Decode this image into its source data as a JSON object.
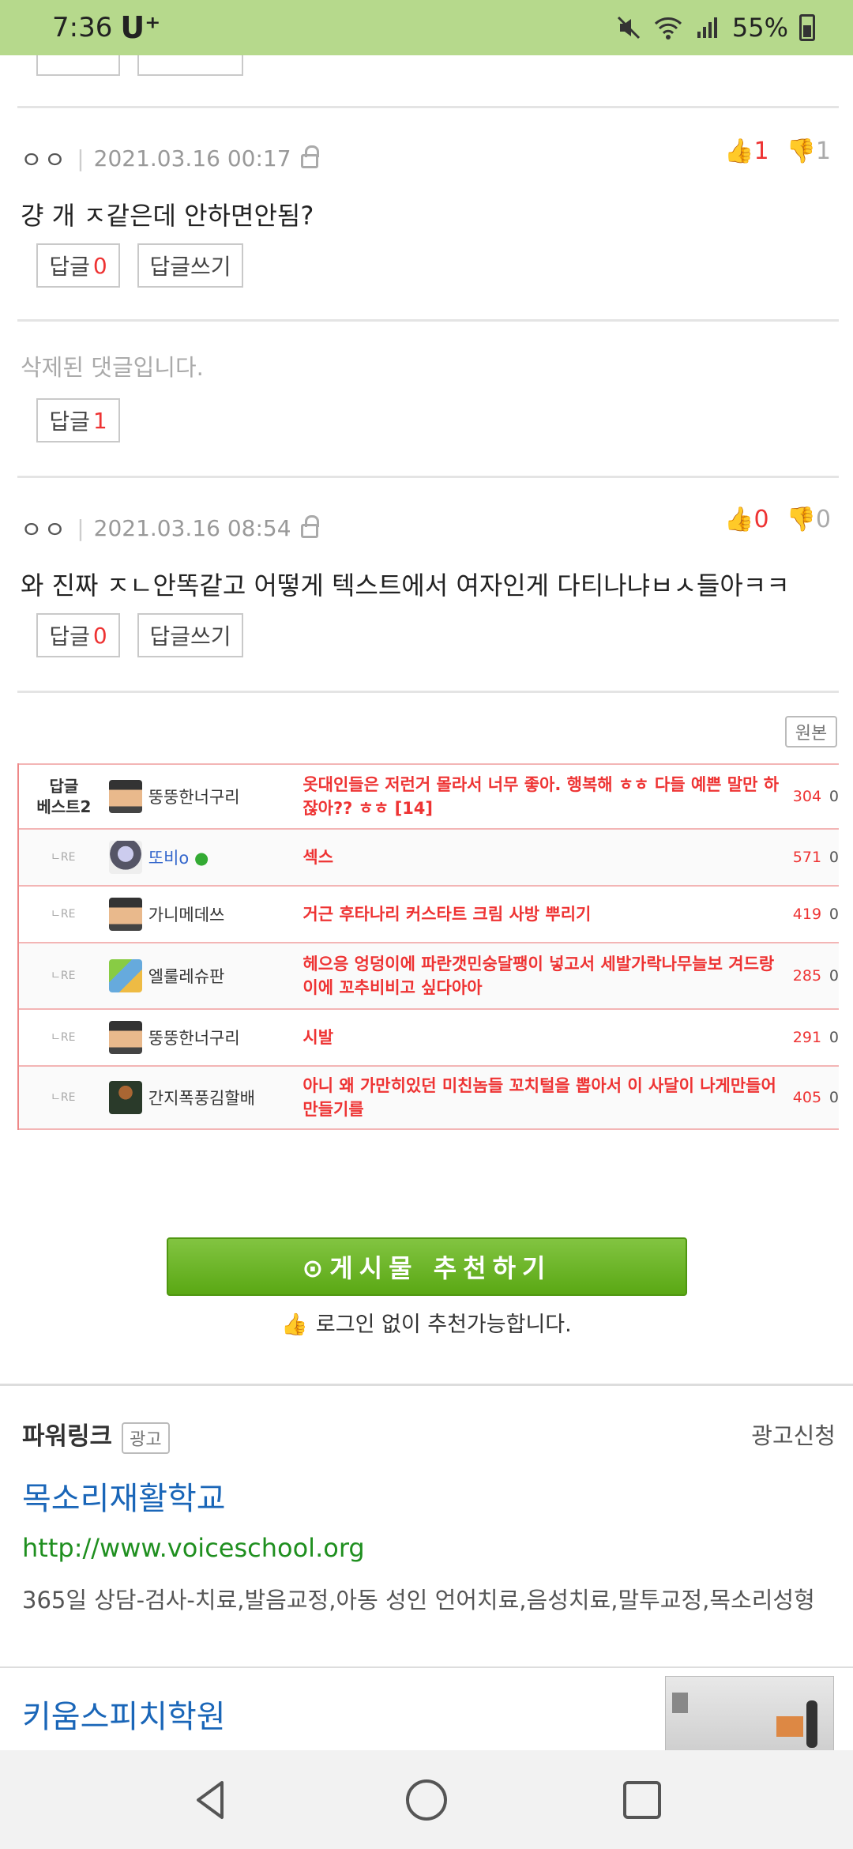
{
  "status": {
    "time": "7:36",
    "carrier": "U⁺",
    "battery": "55%"
  },
  "comments": [
    {
      "nick": "ㅇㅇ",
      "date": "2021.03.16 00:17",
      "up": "1",
      "down": "1",
      "text": "걍 개 ㅈ같은데 안하면안됨?",
      "reply_label": "답글",
      "reply_count": "0",
      "write_label": "답글쓰기"
    },
    {
      "deleted_text": "삭제된 댓글입니다.",
      "reply_label": "답글",
      "reply_count": "1"
    },
    {
      "nick": "ㅇㅇ",
      "date": "2021.03.16 08:54",
      "up": "0",
      "down": "0",
      "text": "와 진짜 ㅈㄴ안똑같고 어떻게 텍스트에서 여자인게 다티나냐ㅂㅅ들아ㅋㅋ",
      "reply_label": "답글",
      "reply_count": "0",
      "write_label": "답글쓰기"
    }
  ],
  "original_label": "원본",
  "best_replies": {
    "label": "답글\n베스트2",
    "re_label": "ㄴRE",
    "rows": [
      {
        "nick": "뚱뚱한너구리",
        "text": "옷대인들은 저런거 몰라서 너무 좋아. 행복해 ㅎㅎ 다들 예쁜 말만 하잖아?? ㅎㅎ [14]",
        "count": "304",
        "zero": "0"
      },
      {
        "nick": "또비o",
        "text": "섹스",
        "count": "571",
        "zero": "0"
      },
      {
        "nick": "가니메데쓰",
        "text": "거근 후타나리 커스타트 크림 사방 뿌리기",
        "count": "419",
        "zero": "0"
      },
      {
        "nick": "엘룰레슈판",
        "text": "헤으응 엉덩이에 파란갯민숭달팽이 넣고서 세발가락나무늘보 겨드랑이에 꼬추비비고 싶다아아",
        "count": "285",
        "zero": "0"
      },
      {
        "nick": "뚱뚱한너구리",
        "text": "시발",
        "count": "291",
        "zero": "0"
      },
      {
        "nick": "간지폭풍김할배",
        "text": "아니 왜 가만히있던 미친놈들 꼬치털을 뽑아서 이 사달이 나게만들어만들기를",
        "count": "405",
        "zero": "0"
      }
    ]
  },
  "recommend": {
    "button": "⊙게시물 추천하기",
    "note": "로그인 없이 추천가능합니다."
  },
  "ads": {
    "header": "파워링크",
    "tag": "광고",
    "apply": "광고신청",
    "items": [
      {
        "title": "목소리재활학교",
        "url": "http://www.voiceschool.org",
        "desc": "365일 상담-검사-치료,발음교정,아동 성인 언어치료,음성치료,말투교정,목소리성형"
      },
      {
        "title": "키움스피치학원"
      }
    ]
  }
}
